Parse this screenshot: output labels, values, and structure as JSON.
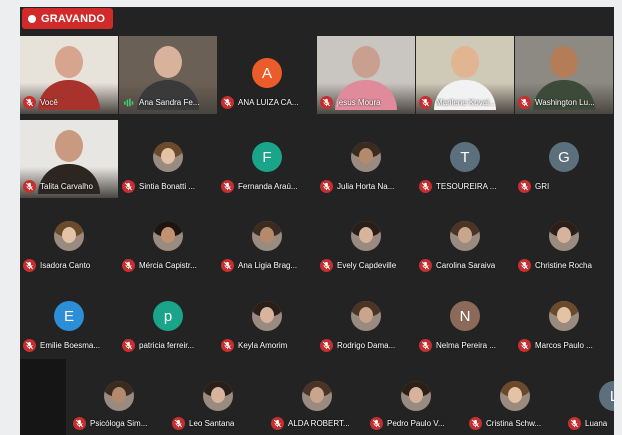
{
  "recording": {
    "label": "GRAVANDO"
  },
  "colors": {
    "recording_red": "#d12a2a",
    "mute_red": "#c62f2f",
    "tile_bg": "#232323"
  },
  "row1": [
    {
      "name": "Você",
      "type": "video",
      "mic": "muted"
    },
    {
      "name": "Ana Sandra Fe...",
      "type": "video",
      "mic": "speaking"
    },
    {
      "name": "ANA LUIZA CA...",
      "type": "initial",
      "initial": "A",
      "color": "#ec5b2a",
      "mic": "muted"
    },
    {
      "name": "jesus Moura",
      "type": "video",
      "mic": "muted"
    },
    {
      "name": "Marilene Kovai...",
      "type": "video",
      "mic": "muted"
    },
    {
      "name": "Washington Lu...",
      "type": "video",
      "mic": "muted"
    }
  ],
  "row2": [
    {
      "name": "Talita Carvalho",
      "type": "video",
      "mic": "muted"
    },
    {
      "name": "Sintia Bonatti ...",
      "type": "photo",
      "mic": "muted"
    },
    {
      "name": "Fernanda Araú...",
      "type": "initial",
      "initial": "F",
      "color": "#1aa58a",
      "mic": "muted"
    },
    {
      "name": "Julia Horta Na...",
      "type": "photo",
      "mic": "muted"
    },
    {
      "name": "TESOUREIRA ...",
      "type": "initial",
      "initial": "T",
      "color": "#5c6f7c",
      "mic": "muted"
    },
    {
      "name": "GRI",
      "type": "initial",
      "initial": "G",
      "color": "#5c6f7c",
      "mic": "muted"
    }
  ],
  "row3": [
    {
      "name": "Isadora Canto",
      "type": "photo",
      "mic": "muted"
    },
    {
      "name": "Mércia Capistr...",
      "type": "photo",
      "mic": "muted"
    },
    {
      "name": "Ana Ligia Brag...",
      "type": "photo",
      "mic": "muted"
    },
    {
      "name": "Evely Capdeville",
      "type": "photo",
      "mic": "muted"
    },
    {
      "name": "Carolina Saraiva",
      "type": "photo",
      "mic": "muted"
    },
    {
      "name": "Christine Rocha",
      "type": "photo",
      "mic": "muted"
    }
  ],
  "row4": [
    {
      "name": "Emilie Boesma...",
      "type": "initial",
      "initial": "E",
      "color": "#2c8ed6",
      "mic": "muted"
    },
    {
      "name": "patricia ferreir...",
      "type": "initial",
      "initial": "p",
      "color": "#1aa58a",
      "mic": "muted"
    },
    {
      "name": "Keyla Amorim",
      "type": "photo",
      "mic": "muted"
    },
    {
      "name": "Rodrigo Dama...",
      "type": "photo",
      "mic": "muted"
    },
    {
      "name": "Nelma Pereira ...",
      "type": "initial",
      "initial": "N",
      "color": "#8c6a5a",
      "mic": "muted"
    },
    {
      "name": "Marcos Paulo ...",
      "type": "photo",
      "mic": "muted"
    }
  ],
  "row5": [
    {
      "name": "Psicóloga Sim...",
      "type": "photo",
      "mic": "muted"
    },
    {
      "name": "Leo Santana",
      "type": "photo",
      "mic": "muted"
    },
    {
      "name": "ALDA ROBERT...",
      "type": "photo",
      "mic": "muted"
    },
    {
      "name": "Pedro Paulo V...",
      "type": "photo",
      "mic": "muted"
    },
    {
      "name": "Cristina Schw...",
      "type": "photo",
      "mic": "muted"
    },
    {
      "name": "Luana",
      "type": "initial",
      "initial": "L",
      "color": "#5c6f7c",
      "mic": "muted"
    }
  ]
}
